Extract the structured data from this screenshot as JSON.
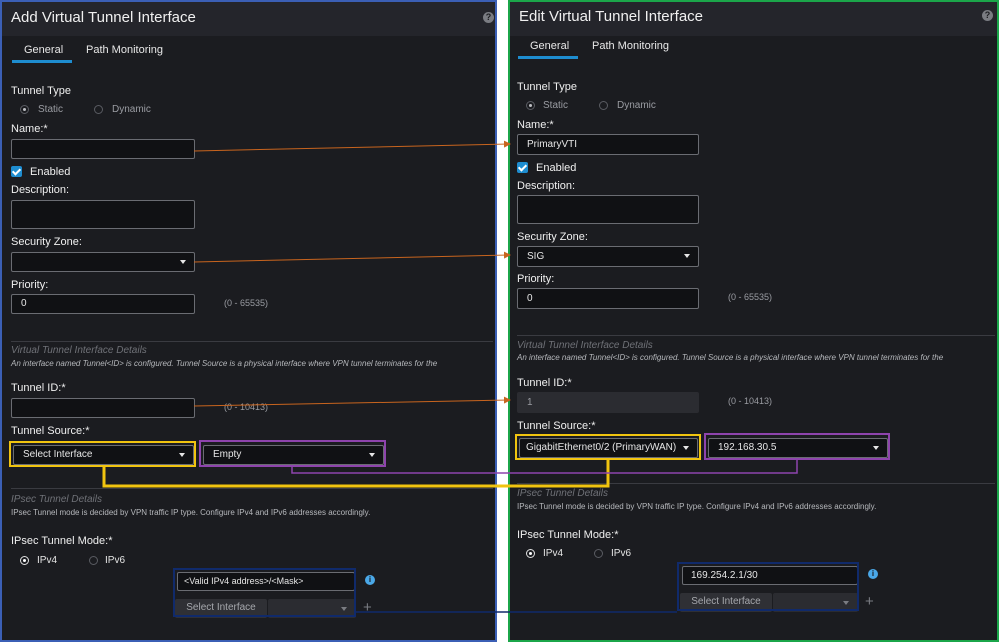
{
  "left": {
    "title": "Add Virtual Tunnel Interface",
    "help": "?",
    "tabs": [
      {
        "label": "General"
      },
      {
        "label": "Path Monitoring"
      }
    ],
    "tunnel_type_label": "Tunnel Type",
    "static_label": "Static",
    "dynamic_label": "Dynamic",
    "name_label": "Name:*",
    "name_value": "",
    "enabled_label": "Enabled",
    "description_label": "Description:",
    "security_zone_label": "Security Zone:",
    "security_zone_value": "",
    "priority_label": "Priority:",
    "priority_value": "0",
    "priority_hint": "(0 - 65535)",
    "vti_section": "Virtual Tunnel Interface Details",
    "vti_desc": "An interface named Tunnel<ID> is configured. Tunnel Source is a physical interface where VPN tunnel terminates for the",
    "tunnel_id_label": "Tunnel ID:*",
    "tunnel_id_value": "",
    "tunnel_id_hint": "(0 - 10413)",
    "tunnel_source_label": "Tunnel Source:*",
    "tunnel_source_value": "Select Interface",
    "tunnel_source_ip": "Empty",
    "ipsec_section": "IPsec Tunnel Details",
    "ipsec_desc": "IPsec Tunnel mode is decided by VPN traffic IP type. Configure IPv4 and IPv6 addresses accordingly.",
    "ipsec_mode_label": "IPsec Tunnel Mode:*",
    "ipv4_label": "IPv4",
    "ipv6_label": "IPv6",
    "ip_value": "<Valid IPv4 address>/<Mask>",
    "select_interface_label": "Select Interface",
    "info_glyph": "i",
    "plus_glyph": "+"
  },
  "right": {
    "title": "Edit Virtual Tunnel Interface",
    "help": "?",
    "tabs": [
      {
        "label": "General"
      },
      {
        "label": "Path Monitoring"
      }
    ],
    "tunnel_type_label": "Tunnel Type",
    "static_label": "Static",
    "dynamic_label": "Dynamic",
    "name_label": "Name:*",
    "name_value": "PrimaryVTI",
    "enabled_label": "Enabled",
    "description_label": "Description:",
    "security_zone_label": "Security Zone:",
    "security_zone_value": "SIG",
    "priority_label": "Priority:",
    "priority_value": "0",
    "priority_hint": "(0 - 65535)",
    "vti_section": "Virtual Tunnel Interface Details",
    "vti_desc": "An interface named Tunnel<ID> is configured. Tunnel Source is a physical interface where VPN tunnel terminates for the",
    "tunnel_id_label": "Tunnel ID:*",
    "tunnel_id_value": "1",
    "tunnel_id_hint": "(0 - 10413)",
    "tunnel_source_label": "Tunnel Source:*",
    "tunnel_source_value": "GigabitEthernet0/2 (PrimaryWAN)",
    "tunnel_source_ip": "192.168.30.5",
    "ipsec_section": "IPsec Tunnel Details",
    "ipsec_desc": "IPsec Tunnel mode is decided by VPN traffic IP type. Configure IPv4 and IPv6 addresses accordingly.",
    "ipsec_mode_label": "IPsec Tunnel Mode:*",
    "ipv4_label": "IPv4",
    "ipv6_label": "IPv6",
    "ip_value": "169.254.2.1/30",
    "select_interface_label": "Select Interface",
    "info_glyph": "i",
    "plus_glyph": "+"
  },
  "colors": {
    "left_border": "#3b5fb5",
    "right_border": "#1ba64a",
    "accent": "#1e8dd0",
    "highlight_source": "#f1c40f",
    "highlight_ip": "#8e44ad",
    "highlight_address": "#102a6b",
    "arrow": "#c8641e"
  }
}
